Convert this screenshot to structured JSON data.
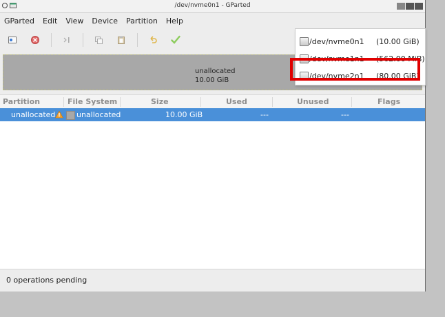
{
  "window": {
    "title": "/dev/nvme0n1 - GParted"
  },
  "menubar": {
    "items": [
      "GParted",
      "Edit",
      "View",
      "Device",
      "Partition",
      "Help"
    ]
  },
  "toolbar": {
    "buttons": [
      {
        "name": "new",
        "icon": "new-partition-icon"
      },
      {
        "name": "delete",
        "icon": "delete-icon"
      },
      {
        "name": "resize",
        "icon": "resize-move-icon"
      },
      {
        "name": "copy",
        "icon": "copy-icon"
      },
      {
        "name": "paste",
        "icon": "paste-icon"
      },
      {
        "name": "undo",
        "icon": "undo-icon"
      },
      {
        "name": "apply",
        "icon": "apply-checkmark-icon"
      }
    ]
  },
  "device_dropdown": {
    "items": [
      {
        "name": "/dev/nvme0n1",
        "size": "(10.00 GiB)"
      },
      {
        "name": "/dev/nvme1n1",
        "size": "(562.00 MiB)"
      },
      {
        "name": "/dev/nvme2n1",
        "size": "(80.00 GiB)"
      }
    ]
  },
  "disk_map": {
    "label": "unallocated",
    "size": "10.00 GiB"
  },
  "table": {
    "columns": [
      "Partition",
      "File System",
      "Size",
      "Used",
      "Unused",
      "Flags"
    ],
    "rows": [
      {
        "partition": "unallocated",
        "filesystem": "unallocated",
        "size": "10.00 GiB",
        "used": "---",
        "unused": "---",
        "flags": ""
      }
    ]
  },
  "status": {
    "text": "0 operations pending"
  },
  "colors": {
    "selection": "#4a90d9",
    "highlight": "#e00000",
    "fs_unallocated": "#a8a8a8"
  }
}
